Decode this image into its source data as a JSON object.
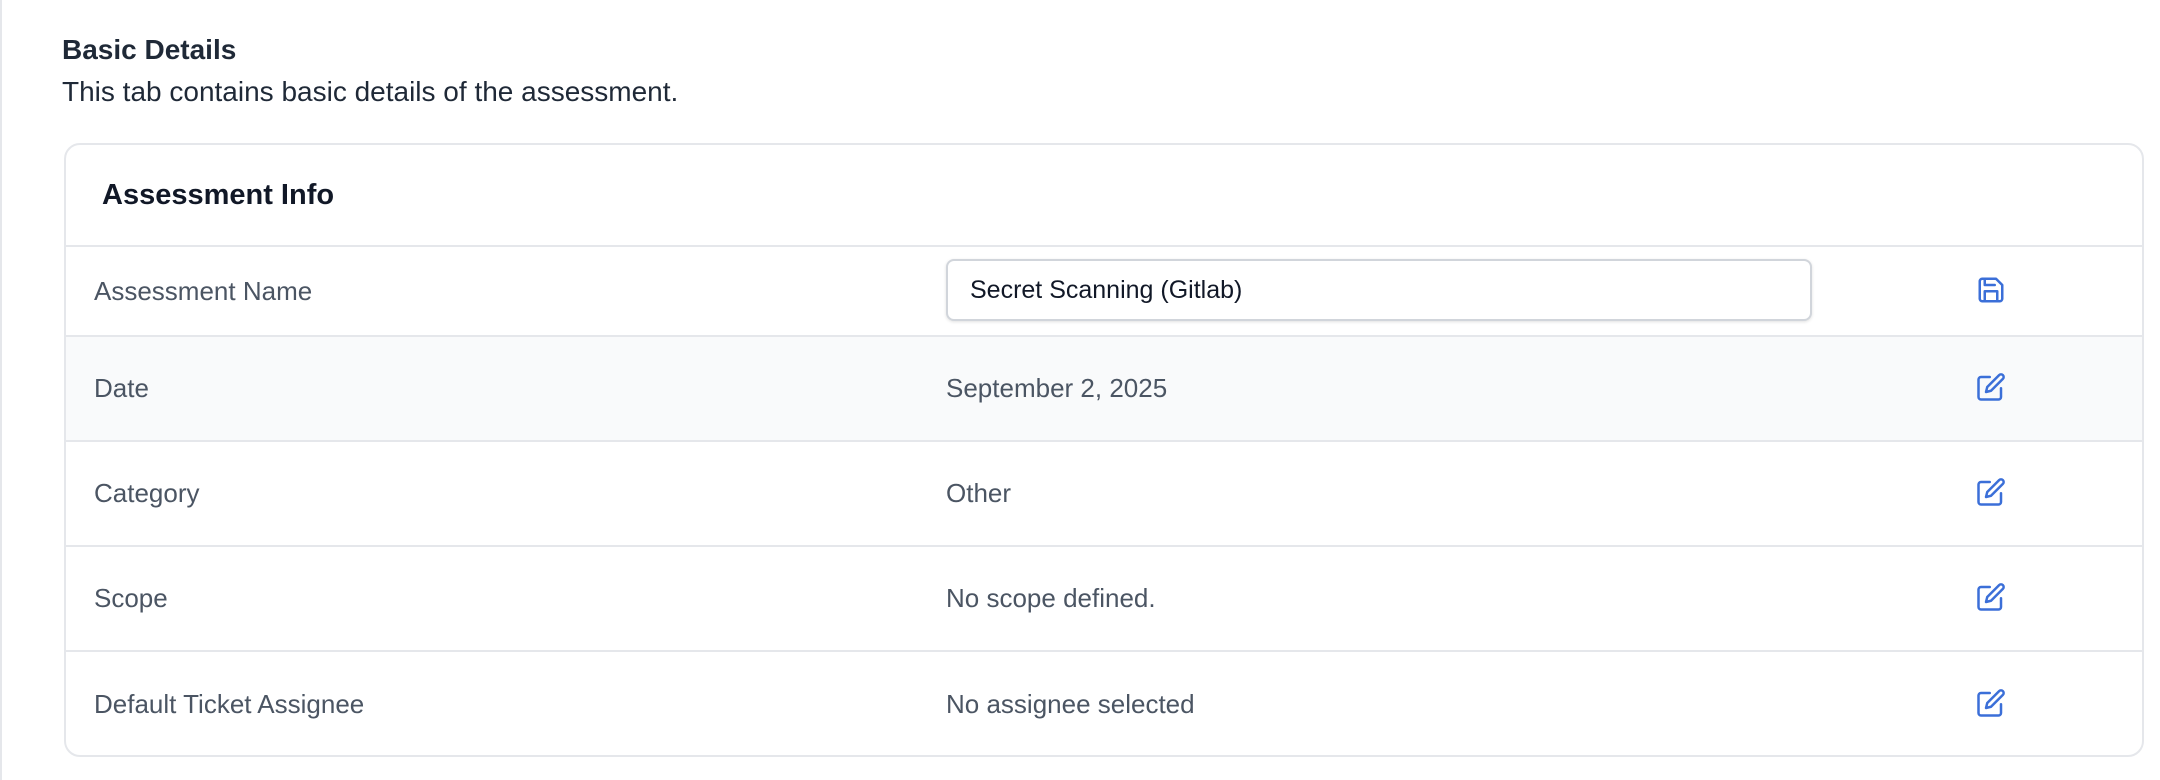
{
  "section": {
    "title": "Basic Details",
    "description": "This tab contains basic details of the assessment."
  },
  "card": {
    "title": "Assessment Info",
    "rows": [
      {
        "label": "Assessment Name",
        "value": "Secret Scanning (Gitlab)",
        "action_icon": "save-icon"
      },
      {
        "label": "Date",
        "value": "September 2, 2025",
        "action_icon": "edit-icon"
      },
      {
        "label": "Category",
        "value": "Other",
        "action_icon": "edit-icon"
      },
      {
        "label": "Scope",
        "value": "No scope defined.",
        "action_icon": "edit-icon"
      },
      {
        "label": "Default Ticket Assignee",
        "value": "No assignee selected",
        "action_icon": "edit-icon"
      }
    ]
  },
  "colors": {
    "accent": "#3b6fd8",
    "label_text": "#4b5563",
    "border": "#e5e7eb"
  }
}
